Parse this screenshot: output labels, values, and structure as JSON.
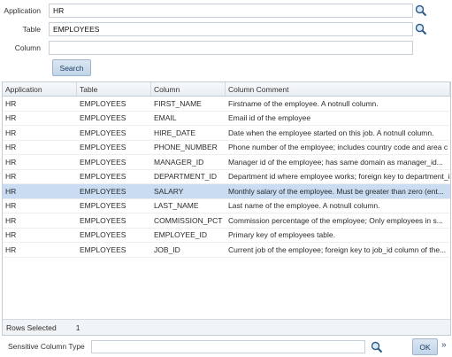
{
  "form": {
    "application": {
      "label": "Application",
      "value": "HR"
    },
    "table": {
      "label": "Table",
      "value": "EMPLOYEES"
    },
    "column": {
      "label": "Column",
      "value": ""
    },
    "search_button": "Search",
    "search_icon": "magnifier-icon"
  },
  "grid": {
    "columns": [
      "Application",
      "Table",
      "Column",
      "Column Comment"
    ],
    "rows": [
      [
        "HR",
        "EMPLOYEES",
        "FIRST_NAME",
        "Firstname of the employee. A notnull column."
      ],
      [
        "HR",
        "EMPLOYEES",
        "EMAIL",
        "Email id of the employee"
      ],
      [
        "HR",
        "EMPLOYEES",
        "HIRE_DATE",
        "Date when the employee started on this job. A notnull column."
      ],
      [
        "HR",
        "EMPLOYEES",
        "PHONE_NUMBER",
        "Phone number of the employee; includes country code and area c"
      ],
      [
        "HR",
        "EMPLOYEES",
        "MANAGER_ID",
        "Manager id of the employee; has same domain as manager_id..."
      ],
      [
        "HR",
        "EMPLOYEES",
        "DEPARTMENT_ID",
        "Department id where employee works; foreign key to department_i"
      ],
      [
        "HR",
        "EMPLOYEES",
        "SALARY",
        "Monthly salary of the employee. Must be greater than zero (ent..."
      ],
      [
        "HR",
        "EMPLOYEES",
        "LAST_NAME",
        "Last name of the employee. A notnull column."
      ],
      [
        "HR",
        "EMPLOYEES",
        "COMMISSION_PCT",
        "Commission percentage of the employee; Only employees in s..."
      ],
      [
        "HR",
        "EMPLOYEES",
        "EMPLOYEE_ID",
        "Primary key of employees table."
      ],
      [
        "HR",
        "EMPLOYEES",
        "JOB_ID",
        "Current job of the employee; foreign key to job_id column of the..."
      ]
    ],
    "selected_index": 6,
    "status": {
      "label": "Rows Selected",
      "count": "1"
    }
  },
  "bottom": {
    "sensitive_label": "Sensitive Column Type",
    "sensitive_value": "",
    "ok_button": "OK",
    "more_icon": "double-chevron-right-icon"
  },
  "colors": {
    "selected_row": "#c9dcf2",
    "button_bg": "#c1d4e8",
    "icon": "#2b5a8a"
  }
}
